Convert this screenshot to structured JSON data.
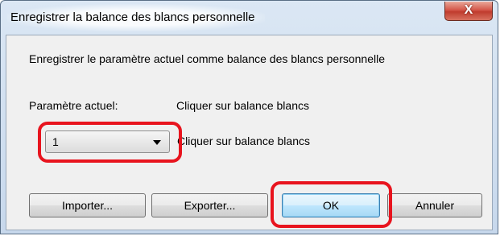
{
  "window": {
    "title": "Enregistrer la balance des blancs personnelle",
    "close_label": "X"
  },
  "dialog": {
    "description": "Enregistrer le paramètre actuel comme balance des blancs personnelle",
    "param_label": "Paramètre actuel:",
    "param_value": "Cliquer sur balance blancs",
    "combo_value": "1",
    "combo_hint": "Cliquer sur balance blancs"
  },
  "buttons": {
    "import_label": "Importer...",
    "export_label": "Exporter...",
    "ok_label": "OK",
    "cancel_label": "Annuler"
  },
  "colors": {
    "highlight": "#e8141e",
    "title_bar": "#c7d8ec",
    "close_button": "#c03c2e"
  }
}
